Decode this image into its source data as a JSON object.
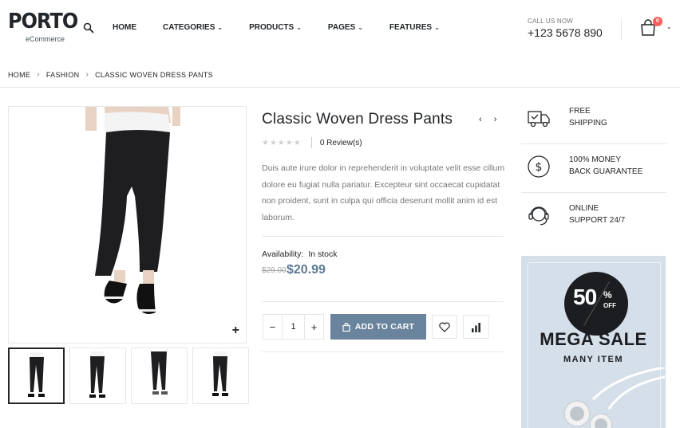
{
  "header": {
    "logo_text": "PORTO",
    "logo_sub": "eCommerce",
    "nav": [
      {
        "label": "HOME",
        "has_dropdown": false
      },
      {
        "label": "CATEGORIES",
        "has_dropdown": true
      },
      {
        "label": "PRODUCTS",
        "has_dropdown": true
      },
      {
        "label": "PAGES",
        "has_dropdown": true
      },
      {
        "label": "FEATURES",
        "has_dropdown": true
      }
    ],
    "call_label": "CALL US NOW",
    "phone": "+123 5678 890",
    "cart_count": "0"
  },
  "breadcrumb": [
    "HOME",
    "FASHION",
    "CLASSIC WOVEN DRESS PANTS"
  ],
  "product": {
    "title": "Classic Woven Dress Pants",
    "reviews": "0 Review(s)",
    "rating": 0,
    "description": "Duis aute irure dolor in reprehenderit in voluptate velit esse cillum dolore eu fugiat nulla pariatur. Excepteur sint occaecat cupidatat non proident, sunt in culpa qui officia deserunt mollit anim id est laborum.",
    "availability_label": "Availability:",
    "availability_value": "In stock",
    "old_price": "$29.00",
    "price": "$20.99",
    "quantity": "1",
    "add_to_cart": "ADD TO CART",
    "thumbnail_count": 4
  },
  "services": [
    {
      "icon": "truck-icon",
      "line1": "FREE",
      "line2": "SHIPPING"
    },
    {
      "icon": "dollar-icon",
      "line1": "100% MONEY",
      "line2": "BACK GUARANTEE"
    },
    {
      "icon": "headset-icon",
      "line1": "ONLINE",
      "line2": "SUPPORT 24/7"
    }
  ],
  "banner": {
    "percent": "50",
    "percent_sign": "%",
    "off": "OFF",
    "title": "MEGA SALE",
    "subtitle": "MANY ITEM"
  },
  "colors": {
    "accent": "#6a849d",
    "price": "#5c7a96",
    "badge": "#ff5b5b",
    "banner_bg": "#d4dfe9",
    "text": "#222529"
  }
}
